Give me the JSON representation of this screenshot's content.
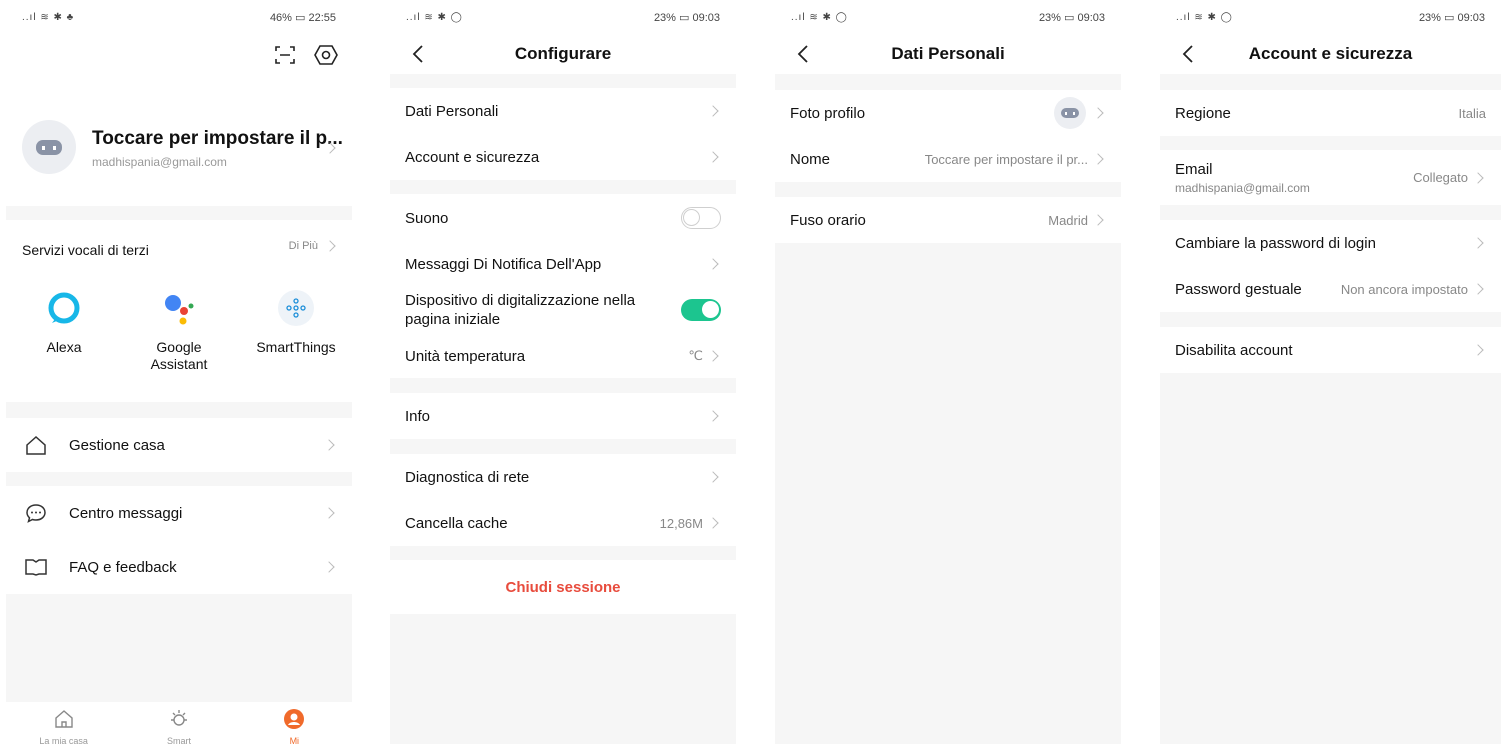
{
  "screen1": {
    "status": {
      "left": "..ıl ≋ ✱ ♣",
      "right": "46% ▭ 22:55"
    },
    "profile": {
      "name": "Toccare per impostare il p...",
      "email": "madhispania@gmail.com"
    },
    "voice": {
      "title": "Servizi vocali di terzi",
      "more": "Di Più"
    },
    "services": [
      {
        "label": "Alexa",
        "icon": "alexa-icon"
      },
      {
        "label": "Google\nAssistant",
        "icon": "google-assistant-icon"
      },
      {
        "label": "SmartThings",
        "icon": "smartthings-icon"
      }
    ],
    "menu": [
      {
        "label": "Gestione casa",
        "icon": "home-outline-icon"
      },
      {
        "label": "Centro messaggi",
        "icon": "chat-bubble-icon"
      },
      {
        "label": "FAQ e feedback",
        "icon": "book-icon"
      }
    ],
    "tabbar": [
      {
        "label": "La mia casa",
        "icon": "home-icon"
      },
      {
        "label": "Smart",
        "icon": "sun-icon"
      },
      {
        "label": "Mi",
        "icon": "person-icon"
      }
    ],
    "accent": "#f06a2b"
  },
  "screen2": {
    "status": {
      "left": "..ıl ≋ ✱ ◯",
      "right": "23% ▭ 09:03"
    },
    "title": "Configurare",
    "rows": {
      "dati": "Dati Personali",
      "account": "Account e sicurezza",
      "suono": "Suono",
      "messaggi": "Messaggi Di Notifica Dell'App",
      "dispositivo": "Dispositivo di digitalizzazione nella pagina iniziale",
      "unita": "Unità temperatura",
      "unita_value": "℃",
      "info": "Info",
      "diagnostica": "Diagnostica di rete",
      "cache": "Cancella cache",
      "cache_value": "12,86M"
    },
    "logout": "Chiudi sessione",
    "toggle_on_color": "#1cc58f",
    "logout_color": "#e84c3d"
  },
  "screen3": {
    "status": {
      "left": "..ıl ≋ ✱ ◯",
      "right": "23% ▭ 09:03"
    },
    "title": "Dati Personali",
    "rows": {
      "foto": "Foto profilo",
      "nome": "Nome",
      "nome_value": "Toccare per impostare il pr...",
      "fuso": "Fuso orario",
      "fuso_value": "Madrid"
    }
  },
  "screen4": {
    "status": {
      "left": "..ıl ≋ ✱ ◯",
      "right": "23% ▭ 09:03"
    },
    "title": "Account e sicurezza",
    "rows": {
      "regione": "Regione",
      "regione_value": "Italia",
      "email": "Email",
      "email_sub": "madhispania@gmail.com",
      "email_value": "Collegato",
      "password": "Cambiare la password di login",
      "gestuale": "Password gestuale",
      "gestuale_value": "Non ancora impostato",
      "disabilita": "Disabilita account"
    }
  }
}
